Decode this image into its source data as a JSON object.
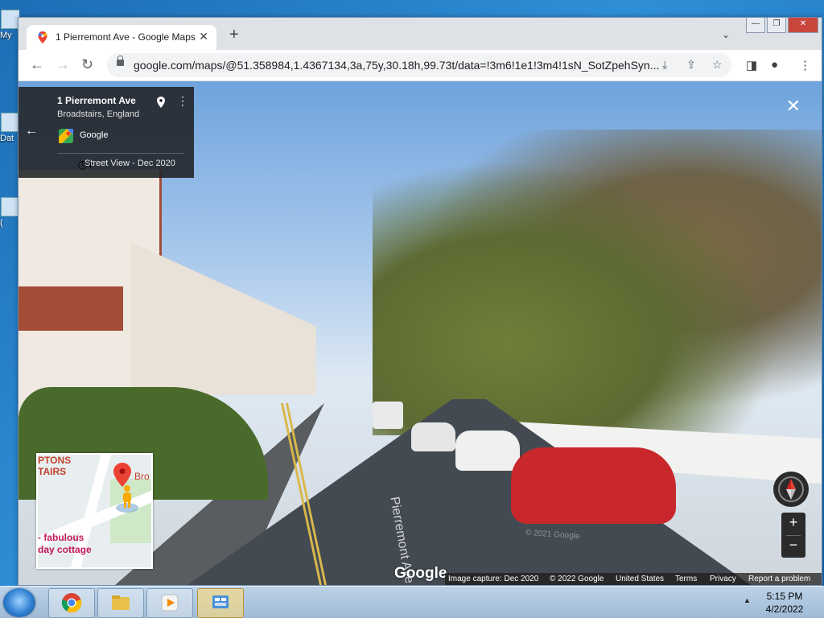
{
  "desktop": {
    "icons": [
      {
        "label": "My"
      },
      {
        "label": "Dat"
      },
      {
        "label": "("
      }
    ]
  },
  "browser": {
    "tab": {
      "title": "1 Pierremont Ave - Google Maps",
      "close": "✕"
    },
    "new_tab": "+",
    "tab_search": "⌄",
    "window_controls": {
      "minimize": "—",
      "restore": "❐",
      "close": "✕"
    },
    "toolbar": {
      "back": "←",
      "forward": "→",
      "reload": "↻",
      "url": "google.com/maps/@51.358984,1.4367134,3a,75y,30.18h,99.73t/data=!3m6!1e1!3m4!1sN_SotZpehSyn...",
      "install_icon": "⤓",
      "share_icon": "⇪",
      "bookmark_icon": "☆",
      "sidepanel_icon": "◨",
      "profile_icon": "●",
      "menu_icon": "⋮"
    }
  },
  "streetview": {
    "info_card": {
      "back": "←",
      "place_name": "1 Pierremont Ave",
      "place_sub": "Broadstairs, England",
      "more": "⋮",
      "publisher": "Google",
      "history_icon": "◷▾",
      "capture_label": "Street View - Dec 2020"
    },
    "close": "✕",
    "street_name": "Pierremont Ave",
    "watermark": "© 2021 Google",
    "google_logo": "Google",
    "minimap": {
      "label_top": "PTONS\nTAIRS",
      "label_right": "Bro",
      "label_bottom": "- fabulous\nday cottage"
    },
    "zoom_in": "+",
    "zoom_out": "−",
    "footer": {
      "image_capture": "Image capture: Dec 2020",
      "copyright": "© 2022 Google",
      "region": "United States",
      "terms": "Terms",
      "privacy": "Privacy",
      "report": "Report a problem"
    }
  },
  "taskbar": {
    "time": "5:15 PM",
    "date": "4/2/2022",
    "tray_arrow": "▲"
  },
  "colors": {
    "info_card_bg": "#202124",
    "pin_red": "#ea4335",
    "car_red": "#c8282b"
  }
}
